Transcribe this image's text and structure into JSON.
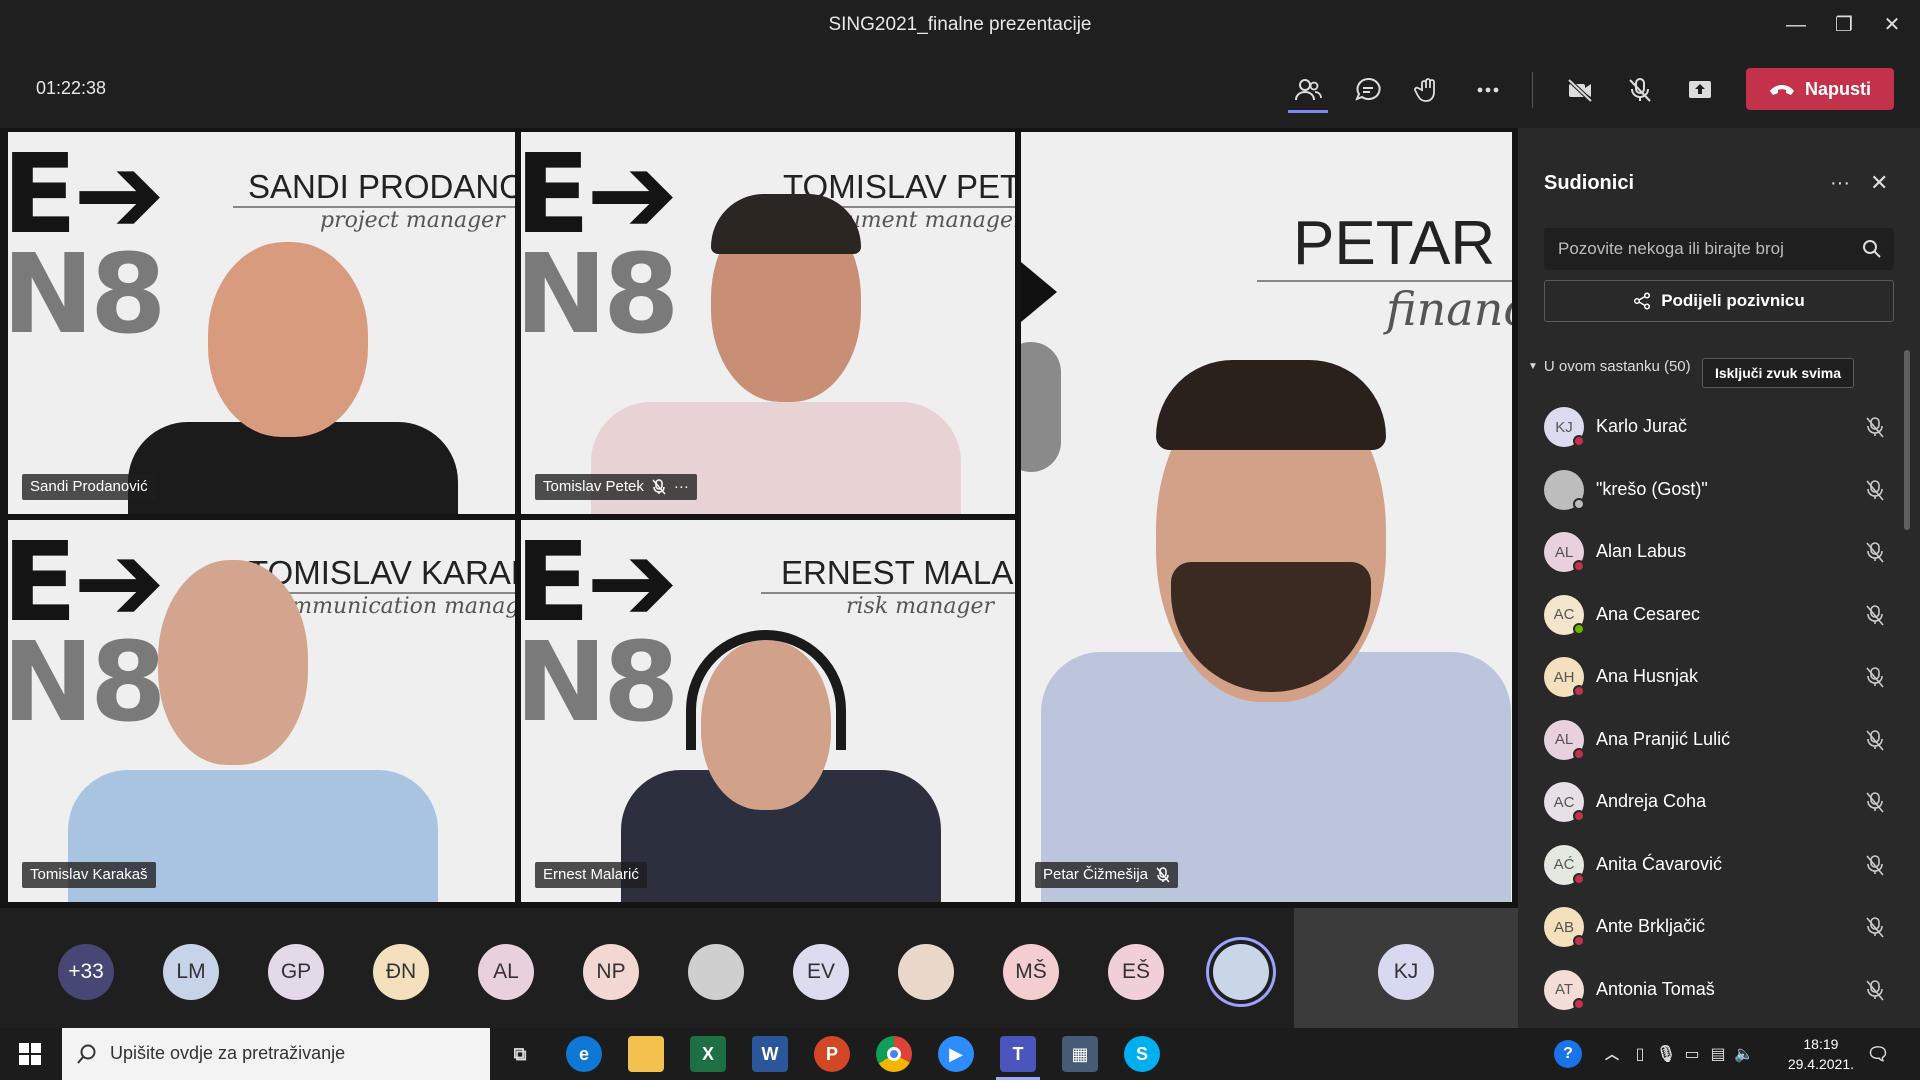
{
  "window": {
    "title": "SING2021_finalne prezentacije"
  },
  "meeting": {
    "timer": "01:22:38",
    "leave_label": "Napusti"
  },
  "tiles": [
    {
      "participant": "Sandi Prodanović",
      "banner_name": "SANDI PRODANOV",
      "banner_role": "project manager"
    },
    {
      "participant": "Tomislav Petek",
      "banner_name": "TOMISLAV PETE",
      "banner_role": "ocument manager"
    },
    {
      "participant": "Tomislav Karakaš",
      "banner_name": "TOMISLAV KARAK",
      "banner_role": "ommunication manag"
    },
    {
      "participant": "Ernest Malarić",
      "banner_name": "ERNEST MALARI",
      "banner_role": "risk manager"
    },
    {
      "participant": "Petar Čižmešija",
      "banner_name": "PETAR (",
      "banner_role": "financ"
    }
  ],
  "avatar_strip": [
    {
      "initials": "+33",
      "color": "#464775"
    },
    {
      "initials": "LM",
      "color": "#c7d3e8"
    },
    {
      "initials": "GP",
      "color": "#e4d9e8"
    },
    {
      "initials": "ĐN",
      "color": "#f4e0bd"
    },
    {
      "initials": "AL",
      "color": "#e8d1dc"
    },
    {
      "initials": "NP",
      "color": "#f2d7d2"
    },
    {
      "initials": "",
      "color": "#cfcfcf"
    },
    {
      "initials": "EV",
      "color": "#dcdcf0"
    },
    {
      "initials": "",
      "color": "#e9d8c9"
    },
    {
      "initials": "MŠ",
      "color": "#f4cdd1"
    },
    {
      "initials": "EŠ",
      "color": "#f0cfd8"
    },
    {
      "initials": "",
      "color": "#c9d6e8"
    },
    {
      "initials": "KJ",
      "color": "#d7d9f0"
    }
  ],
  "panel": {
    "title": "Sudionici",
    "search_placeholder": "Pozovite nekoga ili birajte broj",
    "share_label": "Podijeli pozivnicu",
    "section_label": "U ovom sastanku (50)",
    "mute_all_label": "Isključi zvuk svima",
    "participants": [
      {
        "initials": "KJ",
        "name": "Karlo Jurač",
        "color": "#dcdcf0",
        "status": "#c4314b"
      },
      {
        "initials": "",
        "name": "\"krešo (Gost)\"",
        "color": "#bdbdbd",
        "status": "#bdbdbd"
      },
      {
        "initials": "AL",
        "name": "Alan Labus",
        "color": "#e8d1dc",
        "status": "#c4314b"
      },
      {
        "initials": "AC",
        "name": "Ana Cesarec",
        "color": "#f4e6cc",
        "status": "#6bb700"
      },
      {
        "initials": "AH",
        "name": "Ana Husnjak",
        "color": "#f4e0bd",
        "status": "#c4314b"
      },
      {
        "initials": "AL",
        "name": "Ana Pranjić Lulić",
        "color": "#e8d1dc",
        "status": "#c4314b"
      },
      {
        "initials": "AC",
        "name": "Andreja Coha",
        "color": "#e7e0e6",
        "status": "#c4314b"
      },
      {
        "initials": "AĆ",
        "name": "Anita Ćavarović",
        "color": "#e2eadf",
        "status": "#c4314b"
      },
      {
        "initials": "AB",
        "name": "Ante Brkljačić",
        "color": "#f4e0bd",
        "status": "#c4314b"
      },
      {
        "initials": "AT",
        "name": "Antonia Tomaš",
        "color": "#f4ddd6",
        "status": "#c4314b"
      }
    ]
  },
  "taskbar": {
    "search_placeholder": "Upišite ovdje za pretraživanje",
    "time": "18:19",
    "date": "29.4.2021."
  }
}
